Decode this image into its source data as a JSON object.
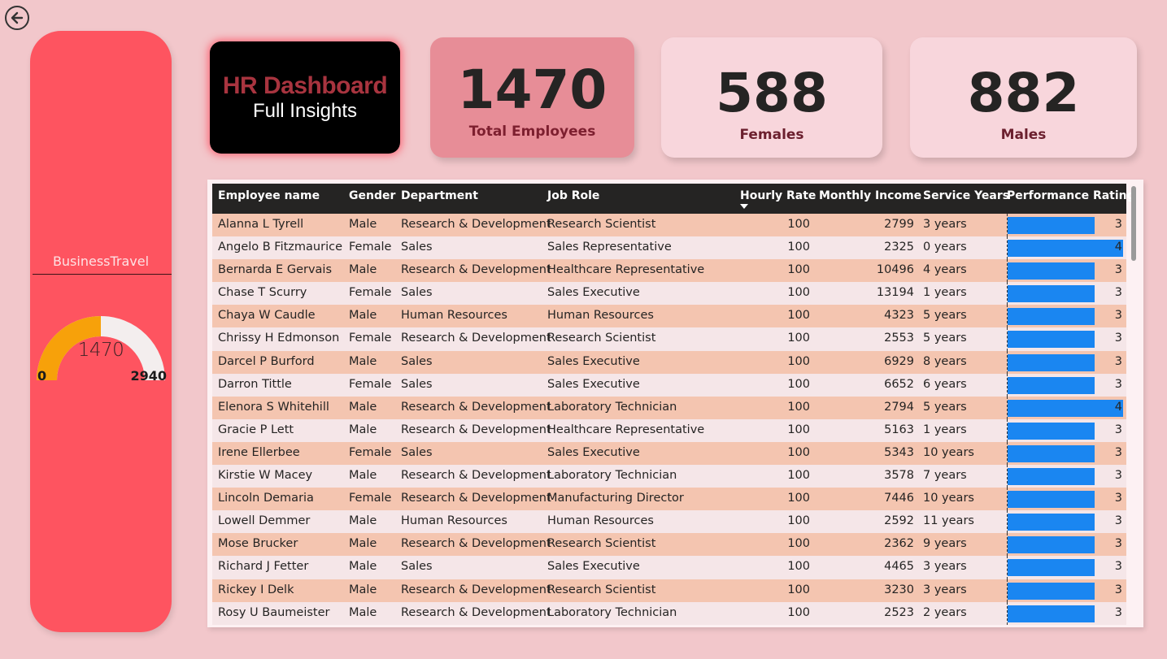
{
  "side_panel": {
    "title": "BusinessTravel",
    "gauge": {
      "value": 1470,
      "value_text": "1470",
      "min": 0,
      "max": 2940,
      "min_text": "0",
      "max_text": "2940",
      "fill_color": "#f7a10a",
      "track_color": "#f3eeee"
    }
  },
  "title_card": {
    "line1": "HR Dashboard",
    "line2": "Full Insights"
  },
  "kpis": {
    "total": {
      "value": "1470",
      "label": "Total Employees"
    },
    "females": {
      "value": "588",
      "label": "Females"
    },
    "males": {
      "value": "882",
      "label": "Males"
    }
  },
  "table": {
    "columns": [
      "Employee name",
      "Gender",
      "Department",
      "Job Role",
      "Hourly Rate",
      "Monthly Income",
      "Service Years",
      "Performance Rating"
    ],
    "rating_max": 4,
    "bar_color": "#1a86f1",
    "rows": [
      [
        "Alanna L Tyrell",
        "Male",
        "Research & Development",
        "Research Scientist",
        "100",
        "2799",
        "3 years",
        "3"
      ],
      [
        "Angelo B Fitzmaurice",
        "Female",
        "Sales",
        "Sales Representative",
        "100",
        "2325",
        "0 years",
        "4"
      ],
      [
        "Bernarda E Gervais",
        "Male",
        "Research & Development",
        "Healthcare Representative",
        "100",
        "10496",
        "4 years",
        "3"
      ],
      [
        "Chase T Scurry",
        "Female",
        "Sales",
        "Sales Executive",
        "100",
        "13194",
        "1 years",
        "3"
      ],
      [
        "Chaya W Caudle",
        "Male",
        "Human Resources",
        "Human Resources",
        "100",
        "4323",
        "5 years",
        "3"
      ],
      [
        "Chrissy H Edmonson",
        "Female",
        "Research & Development",
        "Research Scientist",
        "100",
        "2553",
        "5 years",
        "3"
      ],
      [
        "Darcel P Burford",
        "Male",
        "Sales",
        "Sales Executive",
        "100",
        "6929",
        "8 years",
        "3"
      ],
      [
        "Darron Tittle",
        "Female",
        "Sales",
        "Sales Executive",
        "100",
        "6652",
        "6 years",
        "3"
      ],
      [
        "Elenora S Whitehill",
        "Male",
        "Research & Development",
        "Laboratory Technician",
        "100",
        "2794",
        "5 years",
        "4"
      ],
      [
        "Gracie P Lett",
        "Male",
        "Research & Development",
        "Healthcare Representative",
        "100",
        "5163",
        "1 years",
        "3"
      ],
      [
        "Irene Ellerbee",
        "Female",
        "Sales",
        "Sales Executive",
        "100",
        "5343",
        "10 years",
        "3"
      ],
      [
        "Kirstie W Macey",
        "Male",
        "Research & Development",
        "Laboratory Technician",
        "100",
        "3578",
        "7 years",
        "3"
      ],
      [
        "Lincoln Demaria",
        "Female",
        "Research & Development",
        "Manufacturing Director",
        "100",
        "7446",
        "10 years",
        "3"
      ],
      [
        "Lowell Demmer",
        "Male",
        "Human Resources",
        "Human Resources",
        "100",
        "2592",
        "11 years",
        "3"
      ],
      [
        "Mose Brucker",
        "Male",
        "Research & Development",
        "Research Scientist",
        "100",
        "2362",
        "9 years",
        "3"
      ],
      [
        "Richard J Fetter",
        "Male",
        "Sales",
        "Sales Executive",
        "100",
        "4465",
        "3 years",
        "3"
      ],
      [
        "Rickey I Delk",
        "Male",
        "Research & Development",
        "Research Scientist",
        "100",
        "3230",
        "3 years",
        "3"
      ],
      [
        "Rosy U Baumeister",
        "Male",
        "Research & Development",
        "Laboratory Technician",
        "100",
        "2523",
        "2 years",
        "3"
      ]
    ]
  }
}
